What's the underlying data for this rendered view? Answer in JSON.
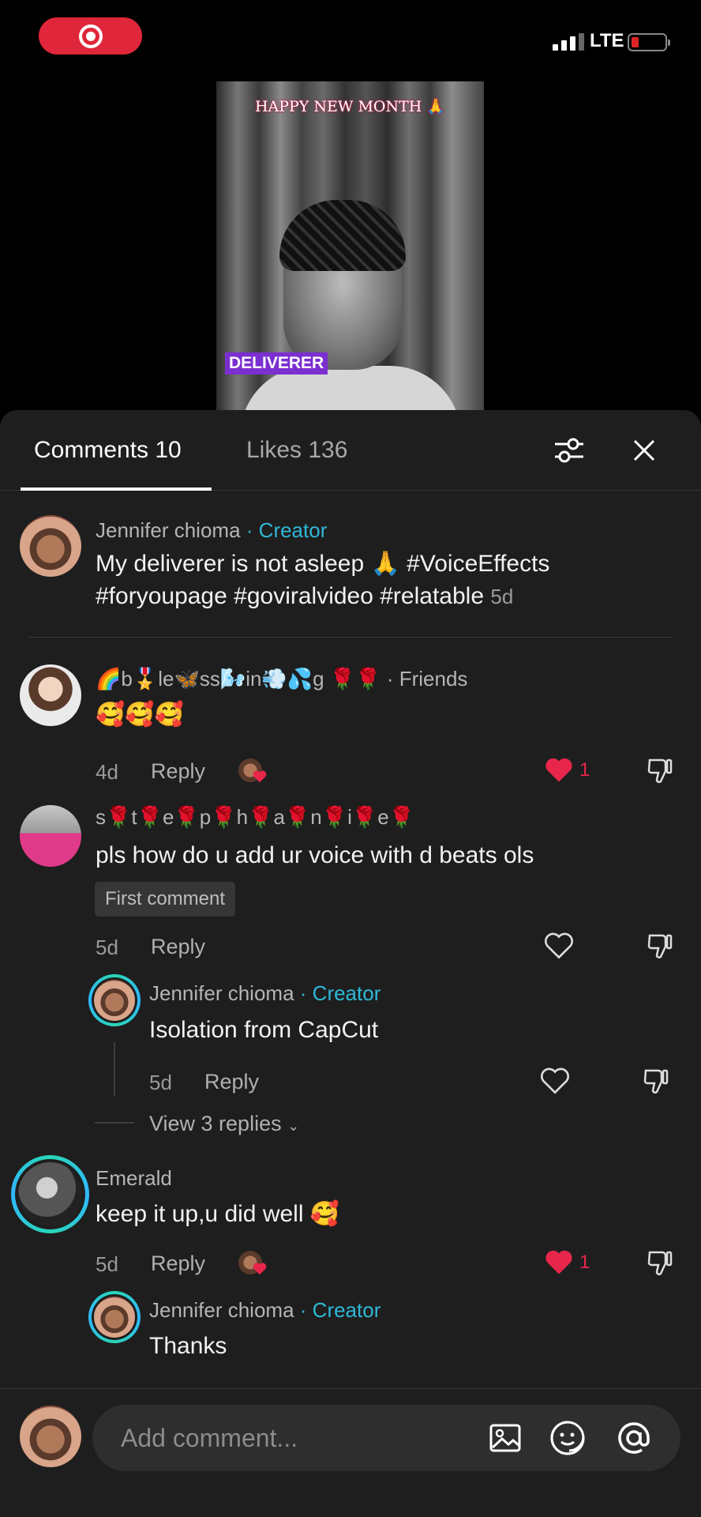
{
  "status_bar": {
    "network": "LTE",
    "signal_bars": 3,
    "battery_level": 0.1
  },
  "video": {
    "overlay_title": "HAPPY NEW MONTH 🙏",
    "tag": "DELIVERER"
  },
  "tabs": {
    "comments": "Comments 10",
    "likes": "Likes 136"
  },
  "comments": [
    {
      "author": "Jennifer chioma",
      "creator_badge": "· Creator",
      "line1": "My deliverer is not asleep 🙏 #VoiceEffects",
      "line2": "#foryoupage #goviralvideo #relatable",
      "time": "5d"
    },
    {
      "author": "🌈b🎖️le🦋ss🌬️in💨💦g 🌹🌹",
      "friends": "· Friends",
      "text": "🥰🥰🥰",
      "time": "4d",
      "reply": "Reply",
      "likes": "1"
    },
    {
      "author": "s🌹t🌹e🌹p🌹h🌹a🌹n🌹i🌹e🌹",
      "text": "pls how do u add ur voice with d beats ols",
      "badge": "First comment",
      "time": "5d",
      "reply": "Reply",
      "sub": {
        "author": "Jennifer chioma",
        "creator_badge": "· Creator",
        "text": "Isolation from CapCut",
        "time": "5d",
        "reply": "Reply"
      },
      "view_replies": "View 3 replies"
    },
    {
      "author": "Emerald",
      "text": "keep it up,u did well 🥰",
      "time": "5d",
      "reply": "Reply",
      "likes": "1",
      "sub": {
        "author": "Jennifer chioma",
        "creator_badge": "· Creator",
        "text": "Thanks"
      }
    }
  ],
  "composer": {
    "placeholder": "Add comment..."
  }
}
